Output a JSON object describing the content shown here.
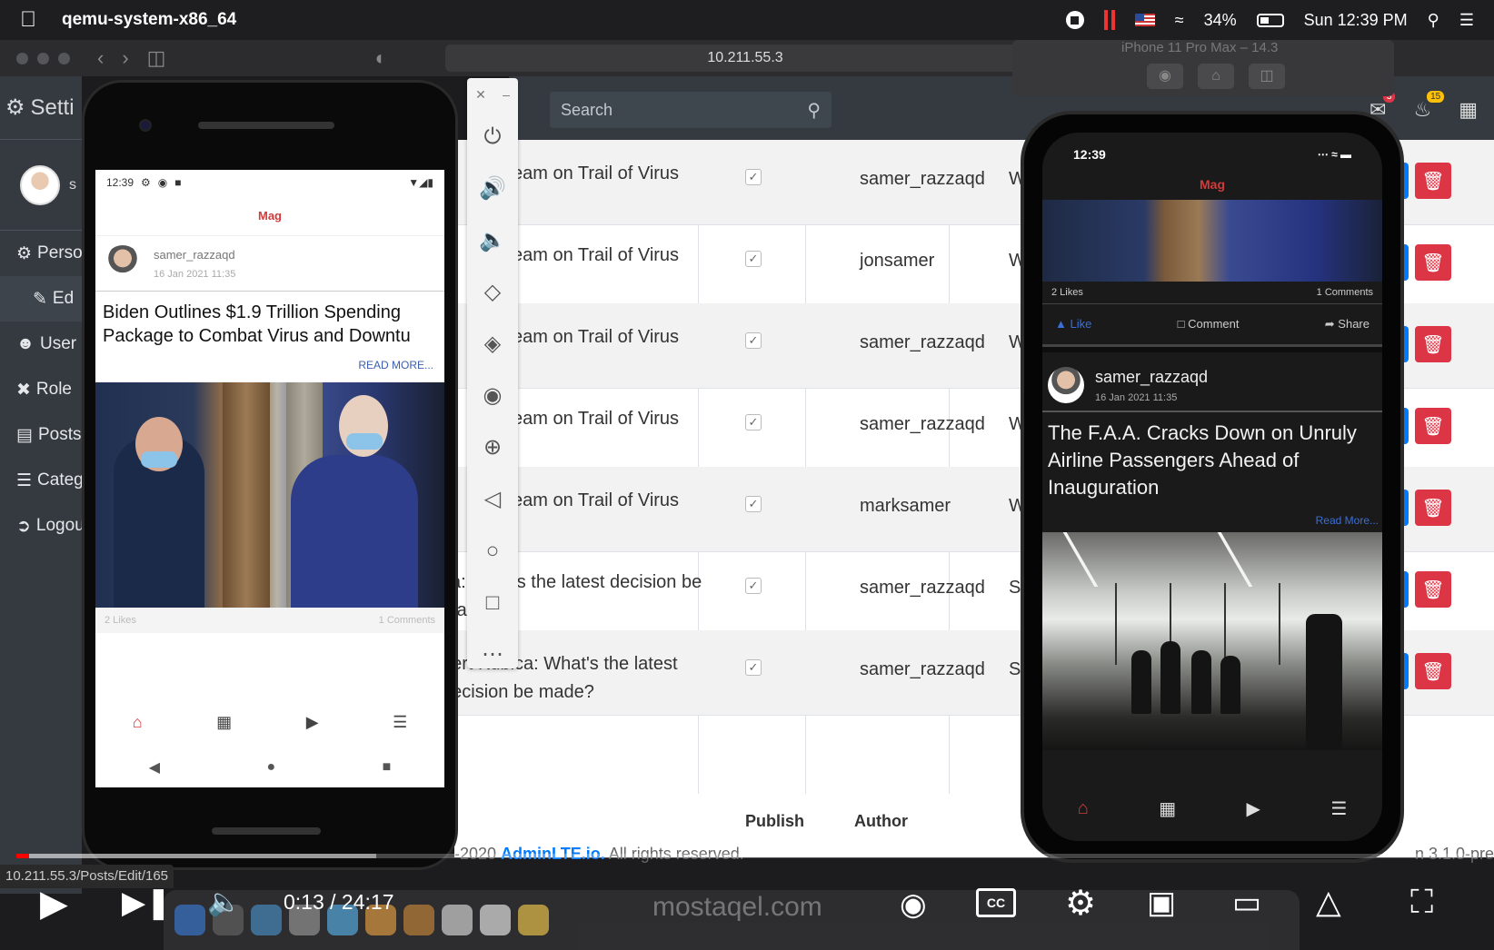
{
  "menubar": {
    "app_name": "qemu-system-x86_64",
    "battery": "34%",
    "clock": "Sun 12:39 PM"
  },
  "browser": {
    "url": "10.211.55.3",
    "status_url": "10.211.55.3/Posts/Edit/165"
  },
  "admin": {
    "sidebar_title": "Setti",
    "sidebar_user": "s",
    "sidebar_items": [
      {
        "label": "Perso",
        "icon": "gear-icon"
      },
      {
        "label": "Ed",
        "icon": "user-edit-icon"
      },
      {
        "label": "User",
        "icon": "users-icon"
      },
      {
        "label": "Role",
        "icon": "tools-icon"
      },
      {
        "label": "Posts",
        "icon": "newspaper-icon"
      },
      {
        "label": "Categ",
        "icon": "list-icon"
      },
      {
        "label": "Logou",
        "icon": "logout-icon"
      }
    ],
    "search_placeholder": "Search",
    "table_rows": [
      {
        "title": "eam on Trail of Virus",
        "author": "samer_razzaqd",
        "extra": "W"
      },
      {
        "title": "eam on Trail of Virus",
        "author": "jonsamer",
        "extra": "W"
      },
      {
        "title": "eam on Trail of Virus",
        "author": "samer_razzaqd",
        "extra": "W"
      },
      {
        "title": "eam on Trail of Virus",
        "author": "samer_razzaqd",
        "extra": "W"
      },
      {
        "title": "eam on Trail of Virus",
        "author": "marksamer",
        "extra": "W"
      },
      {
        "title": "ca: What's the latest decision be made?",
        "author": "samer_razzaqd",
        "extra": "S"
      },
      {
        "title": "bert Kubica: What's the latest decision be made?",
        "author": "samer_razzaqd",
        "extra": "S"
      }
    ],
    "table_foot_publish": "Publish",
    "table_foot_author": "Author",
    "footer_prefix": "-2020 ",
    "footer_brand": "AdminLTE.io.",
    "footer_suffix": " All rights reserved.",
    "footer_version": "n 3.1.0-pre"
  },
  "android": {
    "status_time": "12:39",
    "app_title": "Mag",
    "post_user": "samer_razzaqd",
    "post_date": "16 Jan 2021 11:35",
    "post_title": "Biden Outlines $1.9 Trillion Spending Package to Combat Virus and Downtu",
    "read_more": "READ MORE...",
    "likes": "2 Likes",
    "comments": "1 Comments"
  },
  "ios": {
    "sim_title": "iPhone 11 Pro Max – 14.3",
    "status_time": "12:39",
    "app_title": "Mag",
    "likes": "2 Likes",
    "comments": "1 Comments",
    "like_label": "Like",
    "comment_label": "Comment",
    "share_label": "Share",
    "post_user": "samer_razzaqd",
    "post_date": "16 Jan 2021 11:35",
    "post_title": "The F.A.A. Cracks Down on Unruly Airline Passengers Ahead of Inauguration",
    "read_more": "Read More..."
  },
  "player": {
    "time": "0:13 / 24:17",
    "played_fraction": 0.009,
    "watermark": "mostaqel.com"
  }
}
